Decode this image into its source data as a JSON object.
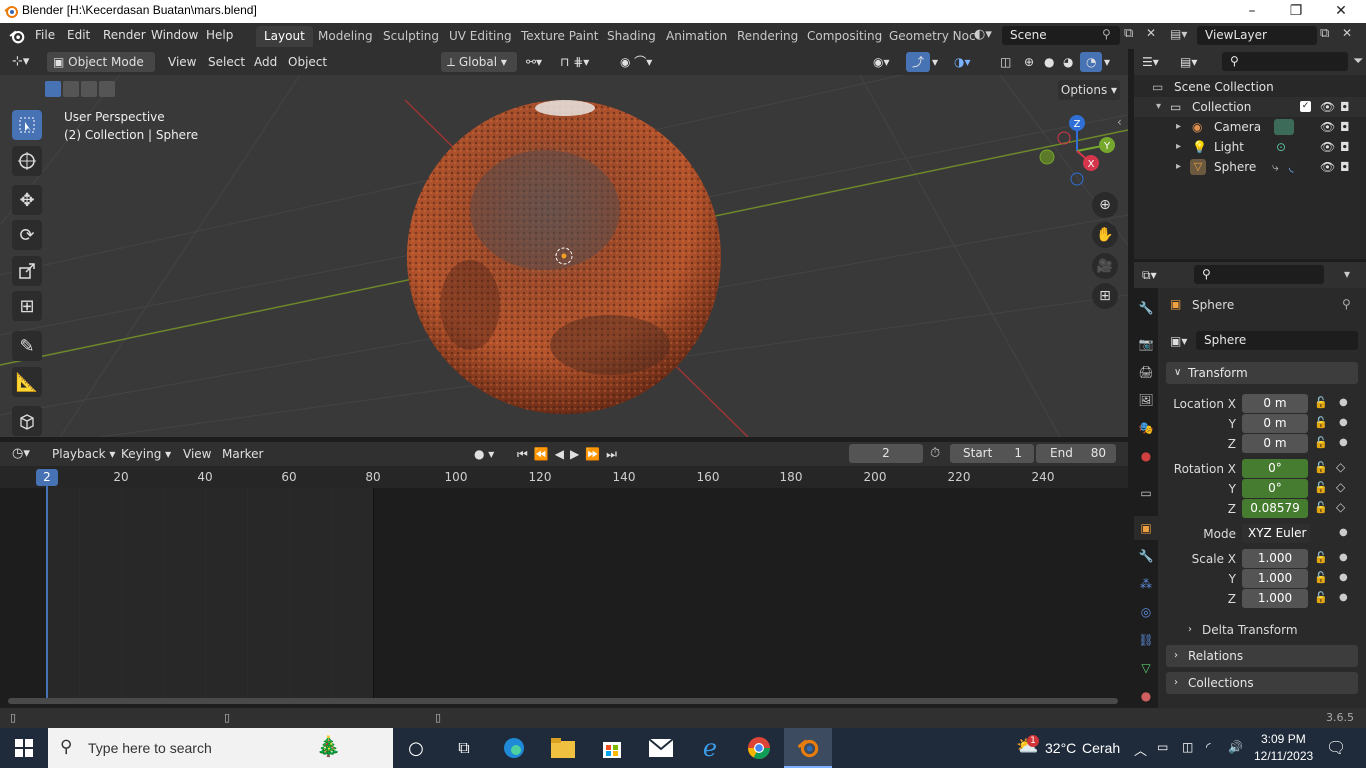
{
  "window": {
    "title": "Blender [H:\\Kecerdasan Buatan\\mars.blend]",
    "minimize": "–",
    "restore": "❐",
    "close": "✕"
  },
  "menu": {
    "file": "File",
    "edit": "Edit",
    "render": "Render",
    "window": "Window",
    "help": "Help"
  },
  "workspaces": [
    {
      "label": "Layout",
      "active": true
    },
    {
      "label": "Modeling"
    },
    {
      "label": "Sculpting"
    },
    {
      "label": "UV Editing"
    },
    {
      "label": "Texture Paint"
    },
    {
      "label": "Shading"
    },
    {
      "label": "Animation"
    },
    {
      "label": "Rendering"
    },
    {
      "label": "Compositing"
    },
    {
      "label": "Geometry Noc"
    }
  ],
  "scene": {
    "label": "Scene"
  },
  "viewlayer": {
    "label": "ViewLayer"
  },
  "viewport_header": {
    "mode": "Object Mode",
    "view": "View",
    "select": "Select",
    "add": "Add",
    "object": "Object",
    "orientation": "Global",
    "options": "Options"
  },
  "viewport": {
    "info_line1": "User Perspective",
    "info_line2": "(2) Collection | Sphere",
    "gizmo": {
      "x": "X",
      "y": "Y",
      "z": "Z"
    }
  },
  "timeline": {
    "playback": "Playback",
    "keying": "Keying",
    "view": "View",
    "marker": "Marker",
    "current_frame": "2",
    "start_label": "Start",
    "start": "1",
    "end_label": "End",
    "end": "80",
    "ticks": [
      "20",
      "40",
      "60",
      "80",
      "100",
      "120",
      "140",
      "160",
      "180",
      "200",
      "220",
      "240"
    ],
    "frame_indicator": "2"
  },
  "outliner": {
    "scene_collection": "Scene Collection",
    "collection": "Collection",
    "items": [
      "Camera",
      "Light",
      "Sphere"
    ]
  },
  "properties": {
    "object_name": "Sphere",
    "data_name": "Sphere",
    "transform": "Transform",
    "location_label": "Location X",
    "location": [
      "0 m",
      "0 m",
      "0 m"
    ],
    "rotation_label": "Rotation X",
    "rotation": [
      "0°",
      "0°",
      "0.08579"
    ],
    "mode_label": "Mode",
    "mode": "XYZ Euler",
    "scale_label": "Scale X",
    "scale": [
      "1.000",
      "1.000",
      "1.000"
    ],
    "y": "Y",
    "z": "Z",
    "delta_transform": "Delta Transform",
    "relations": "Relations",
    "collections": "Collections"
  },
  "status": {
    "version": "3.6.5"
  },
  "taskbar": {
    "search_placeholder": "Type here to search",
    "weather_temp": "32°C",
    "weather_text": "Cerah",
    "time": "3:09 PM",
    "date": "12/11/2023",
    "weather_badge": "1"
  },
  "colors": {
    "accent": "#4772b3",
    "mars": "#b5502a",
    "active_green": "#467c2f"
  }
}
